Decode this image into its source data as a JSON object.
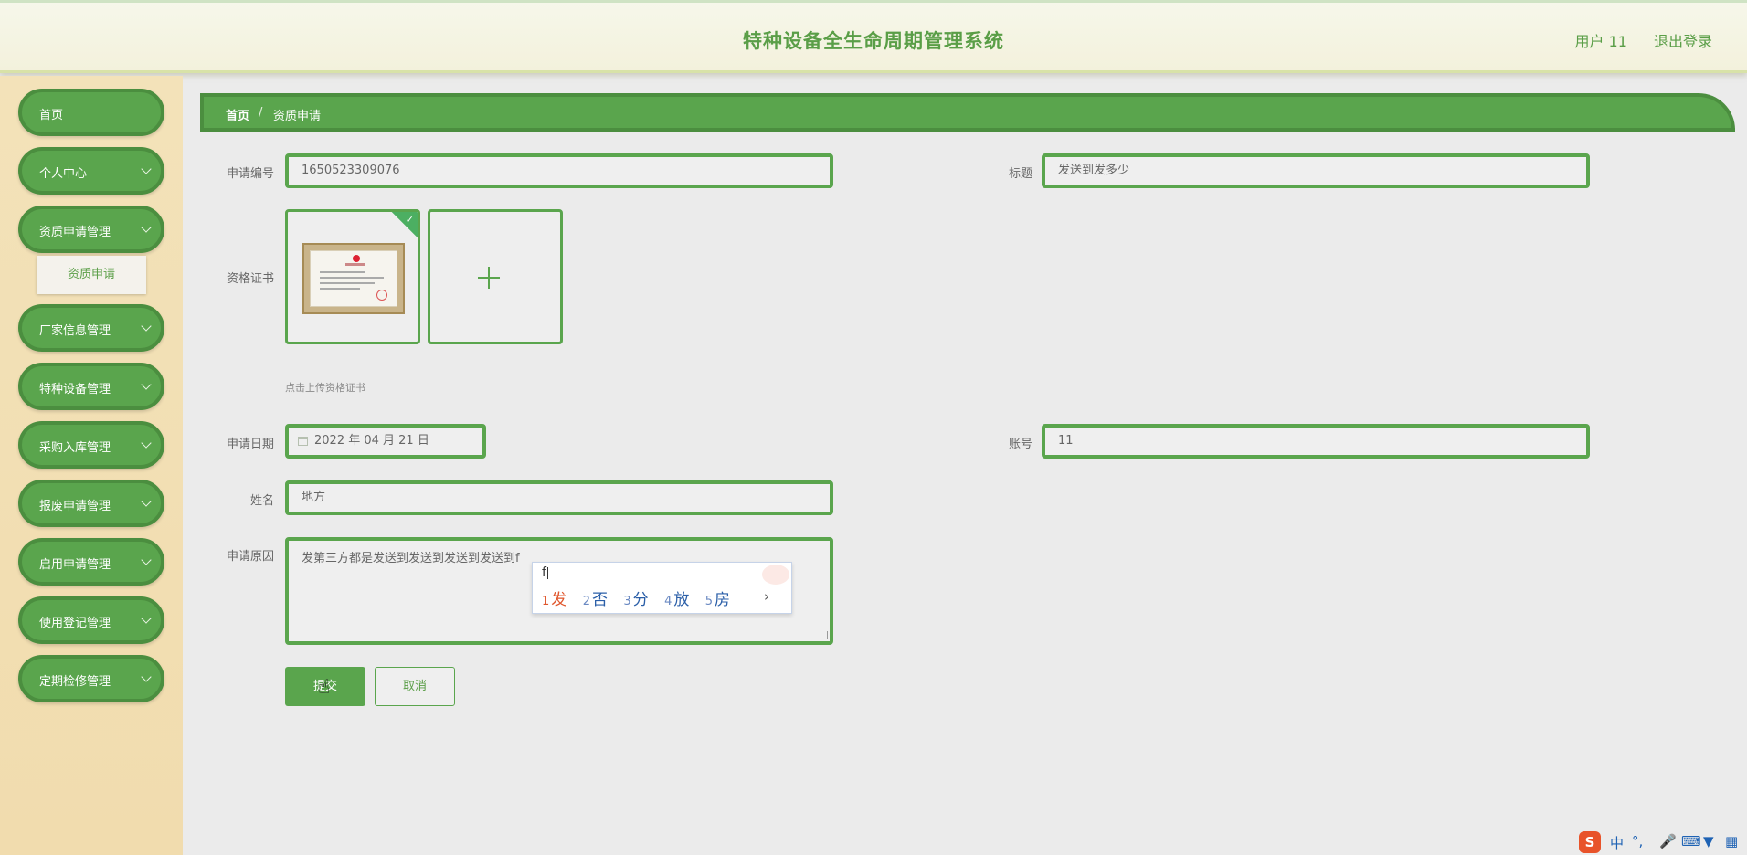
{
  "header": {
    "title": "特种设备全生命周期管理系统",
    "user": "用户 11",
    "logout": "退出登录"
  },
  "sidebar": {
    "items": [
      {
        "label": "首页"
      },
      {
        "label": "个人中心"
      },
      {
        "label": "资质申请管理"
      },
      {
        "label": "厂家信息管理"
      },
      {
        "label": "特种设备管理"
      },
      {
        "label": "采购入库管理"
      },
      {
        "label": "报废申请管理"
      },
      {
        "label": "启用申请管理"
      },
      {
        "label": "使用登记管理"
      },
      {
        "label": "定期检修管理"
      }
    ],
    "sub_item": "资质申请"
  },
  "breadcrumb": {
    "home": "首页",
    "separator": "/",
    "current": "资质申请"
  },
  "form": {
    "app_no_label": "申请编号",
    "app_no_value": "1650523309076",
    "title_label": "标题",
    "title_value": "发送到发多少",
    "cert_label": "资格证书",
    "cert_hint": "点击上传资格证书",
    "date_label": "申请日期",
    "date_value": "2022 年 04 月 21 日",
    "account_label": "账号",
    "account_value": "11",
    "name_label": "姓名",
    "name_value": "地方",
    "reason_label": "申请原因",
    "reason_value": "发第三方都是发送到发送到发送到发送到f",
    "submit": "提交",
    "cancel": "取消"
  },
  "ime": {
    "composition": "f",
    "candidates": [
      {
        "num": "1",
        "char": "发"
      },
      {
        "num": "2",
        "char": "否"
      },
      {
        "num": "3",
        "char": "分"
      },
      {
        "num": "4",
        "char": "放"
      },
      {
        "num": "5",
        "char": "房"
      }
    ],
    "next": "›"
  },
  "tray": {
    "logo": "S",
    "mode": "中",
    "punct": "°,"
  },
  "colors": {
    "primary_green": "#5aa54d",
    "dark_green": "#4b8e3f",
    "title_green": "#5a9e47",
    "sidebar_bg": "#f3e2b9",
    "ime_highlight": "#e0572d"
  }
}
